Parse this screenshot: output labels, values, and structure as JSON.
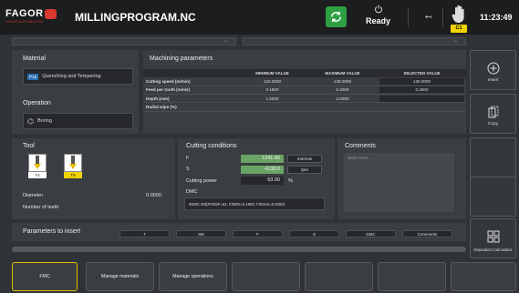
{
  "header": {
    "brand": "FAGOR",
    "brand_sub": "FAGOR AUTOMATION",
    "title": "MILLINGPROGRAM.NC",
    "status": "Ready",
    "channel": "C1",
    "time": "11:23:49"
  },
  "material": {
    "title": "Material",
    "code": "P15",
    "value": "Quenching and Tempering"
  },
  "operation": {
    "title": "Operation",
    "value": "Boring"
  },
  "machining": {
    "title": "Machining parameters",
    "headers": [
      "MINIMUM VALUE",
      "MAXIMUM VALUE",
      "SELECTED VALUE"
    ],
    "rows": [
      {
        "label": "Cutting speed (m/min)",
        "min": "120.0000",
        "max": "145.0000",
        "sel": "130.0000"
      },
      {
        "label": "Feed per tooth (mm/z)",
        "min": "0.1800",
        "max": "0.4000",
        "sel": "0.3000"
      },
      {
        "label": "Depth (mm)",
        "min": "1.5000",
        "max": "2.0000",
        "sel": ""
      },
      {
        "label": "Radial wipe (%)",
        "min": "",
        "max": "",
        "sel": ""
      }
    ]
  },
  "tool": {
    "title": "Tool",
    "cards": [
      "T4",
      "T6"
    ],
    "diameter_label": "Diameter",
    "diameter_value": "0.0000",
    "teeth_label": "Number of teeth"
  },
  "cutting": {
    "title": "Cutting conditions",
    "f_label": "F",
    "f_value": "1241.40",
    "f_unit": "mm/min",
    "s_label": "S",
    "s_value": "4138.0",
    "s_unit": "rpm",
    "power_label": "Cutting power",
    "power_value": "63.00",
    "power_unit": "%",
    "dmc_label": "DMC",
    "dmc_value": "#DMC ON[PARSP=63, FZMIN=0.1800, FZMAX=0.4000]"
  },
  "comments": {
    "title": "Comments",
    "placeholder": "Write here..."
  },
  "insert": {
    "title": "Parameters to insert",
    "buttons": [
      "T",
      "M6",
      "F",
      "S",
      "DMC",
      "Comments"
    ]
  },
  "side": {
    "insert": "Insert",
    "copy": "Copy",
    "calculator": "Standard Calculator"
  },
  "bottom": [
    "FMC",
    "Manage materials",
    "Manage operations"
  ],
  "colors": {
    "accent_green": "#2ea043",
    "active_yellow": "#f0d300",
    "brand_red": "#d8382f"
  }
}
